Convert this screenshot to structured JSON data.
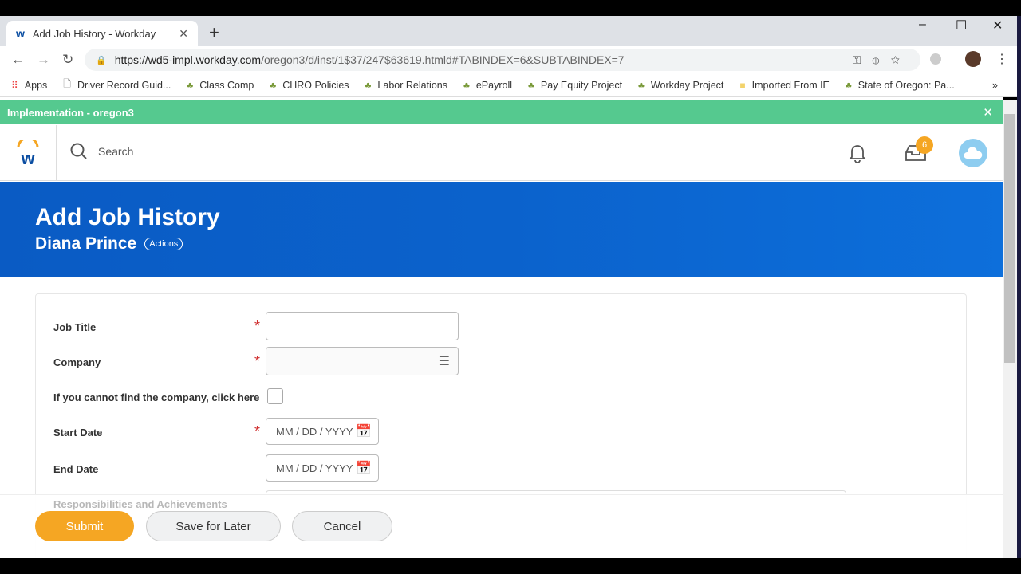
{
  "browser": {
    "tab_title": "Add Job History - Workday",
    "url_host": "https://wd5-impl.workday.com",
    "url_path": "/oregon3/d/inst/1$37/247$63619.htmld#TABINDEX=6&SUBTABINDEX=7",
    "bookmarks": [
      "Apps",
      "Driver Record Guid...",
      "Class Comp",
      "CHRO Policies",
      "Labor Relations",
      "ePayroll",
      "Pay Equity Project",
      "Workday Project",
      "Imported From IE",
      "State of Oregon: Pa..."
    ],
    "more": "»"
  },
  "env_banner": "Implementation - oregon3",
  "header": {
    "search_placeholder": "Search",
    "inbox_count": "6"
  },
  "page": {
    "title": "Add Job History",
    "worker": "Diana Prince",
    "actions": "Actions"
  },
  "form": {
    "job_title": "Job Title",
    "company": "Company",
    "cannot_find": "If you cannot find the company, click here",
    "start_date": "Start Date",
    "end_date": "End Date",
    "date_placeholder": "MM / DD / YYYY",
    "responsibilities": "Responsibilities and Achievements",
    "required_mark": "*"
  },
  "footer": {
    "submit": "Submit",
    "save": "Save for Later",
    "cancel": "Cancel"
  },
  "colors": {
    "accent": "#f5a623",
    "banner": "#0b62cc",
    "env": "#55c98f"
  }
}
